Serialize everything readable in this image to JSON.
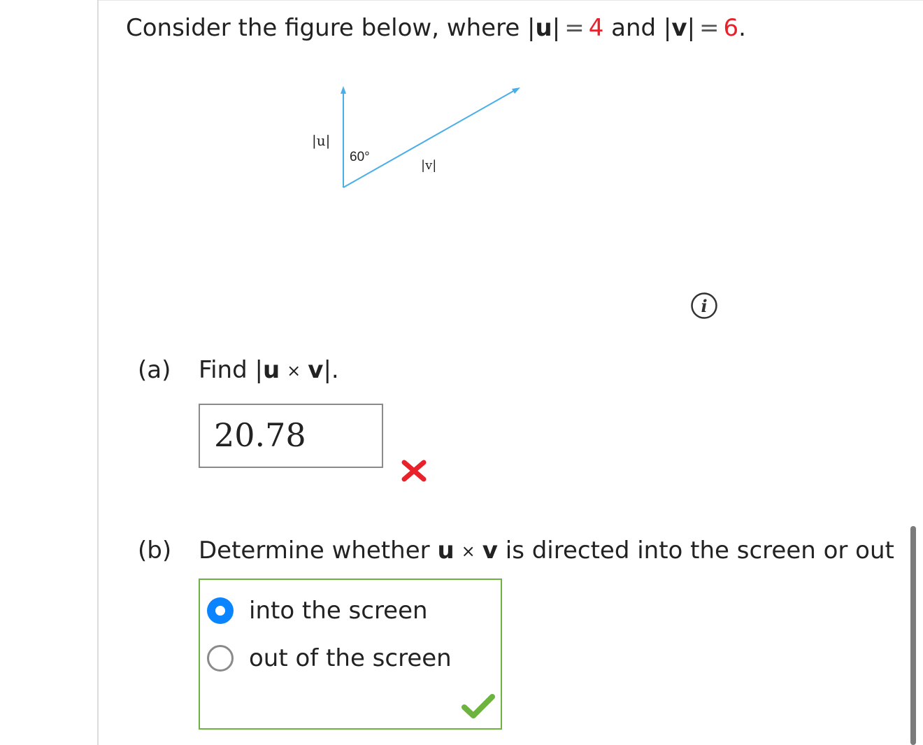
{
  "question": {
    "prefix": "Consider the figure below, where |",
    "u": "u",
    "mid1": "|",
    "eq": "=",
    "u_value": "4",
    "and": " and |",
    "v": "v",
    "mid2": "|",
    "v_value": "6",
    "end": "."
  },
  "figure": {
    "u_label": "|u|",
    "angle_label": "60°",
    "v_label": "|v|",
    "line_color": "#4aaee8"
  },
  "part_a": {
    "label": "(a)",
    "prompt_start": "Find |",
    "u": "u",
    "times": "×",
    "v": "v",
    "prompt_end": "|.",
    "answer": "20.78",
    "status": "incorrect"
  },
  "part_b": {
    "label": "(b)",
    "prompt_start": "Determine whether ",
    "u": "u",
    "times": "×",
    "v": "v",
    "prompt_end": " is directed into the screen or out",
    "options": [
      "into the screen",
      "out of the screen"
    ],
    "selected": "into the screen",
    "status": "correct"
  },
  "colors": {
    "accent_blue": "#0a84ff",
    "error_red": "#e8212a",
    "success_green": "#6cb33f"
  },
  "icons": [
    "info-icon",
    "wrong-mark-icon",
    "check-mark-icon",
    "radio-selected-icon",
    "radio-unselected-icon"
  ]
}
